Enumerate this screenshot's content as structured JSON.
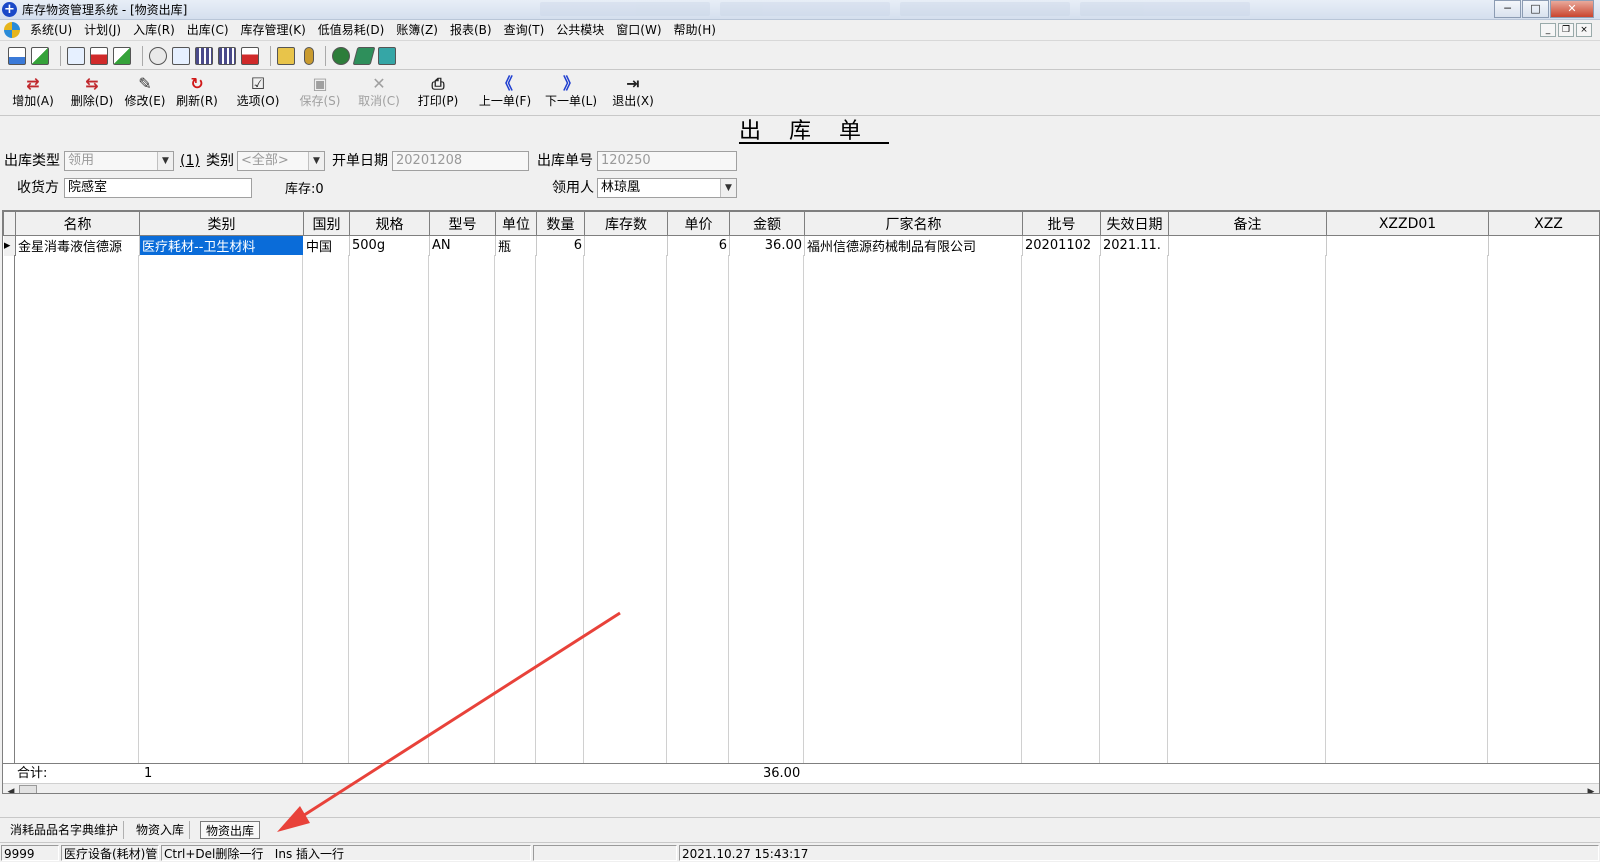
{
  "window": {
    "title": "库存物资管理系统 - [物资出库]",
    "controls": {
      "minimize": "─",
      "maximize": "□",
      "close": "✕"
    },
    "mdi_controls": [
      "_",
      "❐",
      "×"
    ]
  },
  "menu": [
    "系统(U)",
    "计划(J)",
    "入库(R)",
    "出库(C)",
    "库存管理(K)",
    "低值易耗(D)",
    "账簿(Z)",
    "报表(B)",
    "查询(T)",
    "公共模块",
    "窗口(W)",
    "帮助(H)"
  ],
  "toolbar_icons": [
    "open-icon",
    "save-icon",
    "document-icon",
    "print-preview-icon",
    "chart-icon",
    "search-icon",
    "edit-icon",
    "grid-icon",
    "calculator-icon",
    "user-icon",
    "lock-icon",
    "key-icon",
    "circle-icon",
    "book-icon",
    "exit-icon"
  ],
  "actions": [
    {
      "icon": "⇄",
      "label": "增加(A)",
      "enabled": true,
      "color": "#c0282d"
    },
    {
      "icon": "⇆",
      "label": "删除(D)",
      "enabled": true,
      "color": "#c0282d"
    },
    {
      "icon": "✎",
      "label": "修改(E)",
      "enabled": true,
      "color": "#333333"
    },
    {
      "icon": "↻",
      "label": "刷新(R)",
      "enabled": true,
      "color": "#d01818"
    },
    {
      "icon": "☑",
      "label": "选项(O)",
      "enabled": true,
      "color": "#333333"
    },
    {
      "icon": "▣",
      "label": "保存(S)",
      "enabled": false,
      "color": "#a0a0a0"
    },
    {
      "icon": "✕",
      "label": "取消(C)",
      "enabled": false,
      "color": "#a0a0a0"
    },
    {
      "icon": "⎙",
      "label": "打印(P)",
      "enabled": true,
      "color": "#222222"
    },
    {
      "icon": "《",
      "label": "上一单(F)",
      "enabled": true,
      "color": "#1f3fd0"
    },
    {
      "icon": "》",
      "label": "下一单(L)",
      "enabled": true,
      "color": "#1f3fd0"
    },
    {
      "icon": "⇥",
      "label": "退出(X)",
      "enabled": true,
      "color": "#222222"
    }
  ],
  "form": {
    "title": "出库单",
    "outbound_type_label": "出库类型",
    "outbound_type_value": "领用",
    "category_hint": "(1)",
    "category_label": "类别",
    "category_value": "<全部>",
    "open_date_label": "开单日期",
    "open_date_value": "20201208",
    "order_no_label": "出库单号",
    "order_no_value": "120250",
    "receiver_label": "收货方",
    "receiver_value": "院感室",
    "stock_label": "库存:0",
    "requester_label": "领用人",
    "requester_value": "林琼凰"
  },
  "grid": {
    "columns": [
      "名称",
      "类别",
      "国别",
      "规格",
      "型号",
      "单位",
      "数量",
      "库存数",
      "单价",
      "金额",
      "厂家名称",
      "批号",
      "失效日期",
      "备注",
      "XZZD01",
      "XZZ"
    ],
    "rows": [
      [
        "金星消毒液信德源",
        "医疗耗材--卫生材料",
        "中国",
        "500g",
        "AN",
        "瓶",
        "6",
        "",
        "6",
        "36.00",
        "福州信德源药械制品有限公司",
        "20201102",
        "2021.11.",
        "",
        "",
        ""
      ]
    ],
    "total_label": "合计:",
    "total_count": "1",
    "total_amount": "36.00"
  },
  "tabs": [
    "消耗品品名字典维护",
    "物资入库",
    "物资出库"
  ],
  "active_tab": "物资出库",
  "status": {
    "code": "9999",
    "module": "医疗设备(耗材)管理",
    "hint": "Ctrl+Del删除一行   Ins 插入一行",
    "datetime": "2021.10.27 15:43:17"
  },
  "colors": {
    "selection": "#0a6cd9",
    "annotation_arrow": "#e8423a"
  }
}
